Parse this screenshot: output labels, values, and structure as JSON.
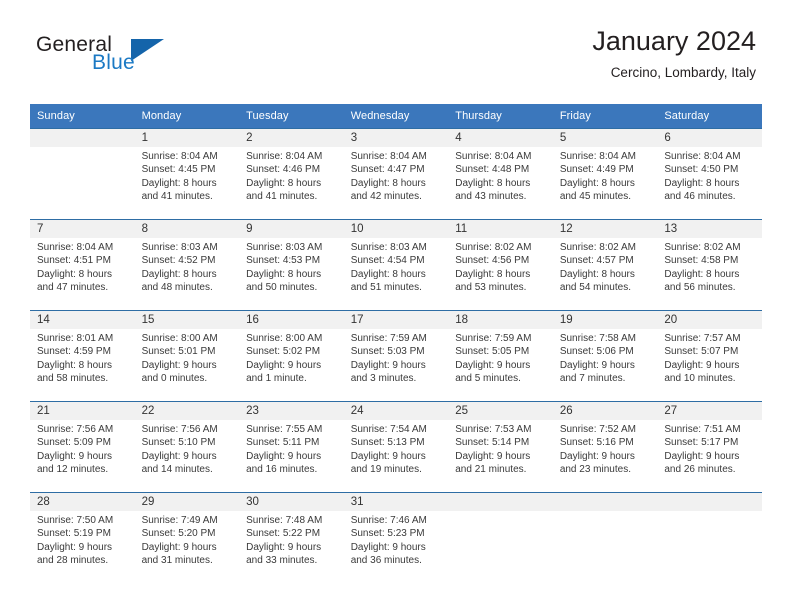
{
  "brand": {
    "name_part1": "General",
    "name_part2": "Blue",
    "triangle_color": "#1464AA",
    "blue_color": "#1B79C4"
  },
  "header": {
    "title": "January 2024",
    "subtitle": "Cercino, Lombardy, Italy"
  },
  "theme": {
    "header_row_bg": "#3B77BC",
    "row_divider": "#2E6DA4",
    "daynum_band_bg": "#F1F1F1",
    "text_color": "#231F20"
  },
  "calendar": {
    "weekday_headers": [
      "Sunday",
      "Monday",
      "Tuesday",
      "Wednesday",
      "Thursday",
      "Friday",
      "Saturday"
    ],
    "weeks": [
      [
        {
          "day": "",
          "sunrise": "",
          "sunset": "",
          "daylight_line1": "",
          "daylight_line2": "",
          "empty": true
        },
        {
          "day": "1",
          "sunrise": "Sunrise: 8:04 AM",
          "sunset": "Sunset: 4:45 PM",
          "daylight_line1": "Daylight: 8 hours",
          "daylight_line2": "and 41 minutes."
        },
        {
          "day": "2",
          "sunrise": "Sunrise: 8:04 AM",
          "sunset": "Sunset: 4:46 PM",
          "daylight_line1": "Daylight: 8 hours",
          "daylight_line2": "and 41 minutes."
        },
        {
          "day": "3",
          "sunrise": "Sunrise: 8:04 AM",
          "sunset": "Sunset: 4:47 PM",
          "daylight_line1": "Daylight: 8 hours",
          "daylight_line2": "and 42 minutes."
        },
        {
          "day": "4",
          "sunrise": "Sunrise: 8:04 AM",
          "sunset": "Sunset: 4:48 PM",
          "daylight_line1": "Daylight: 8 hours",
          "daylight_line2": "and 43 minutes."
        },
        {
          "day": "5",
          "sunrise": "Sunrise: 8:04 AM",
          "sunset": "Sunset: 4:49 PM",
          "daylight_line1": "Daylight: 8 hours",
          "daylight_line2": "and 45 minutes."
        },
        {
          "day": "6",
          "sunrise": "Sunrise: 8:04 AM",
          "sunset": "Sunset: 4:50 PM",
          "daylight_line1": "Daylight: 8 hours",
          "daylight_line2": "and 46 minutes."
        }
      ],
      [
        {
          "day": "7",
          "sunrise": "Sunrise: 8:04 AM",
          "sunset": "Sunset: 4:51 PM",
          "daylight_line1": "Daylight: 8 hours",
          "daylight_line2": "and 47 minutes."
        },
        {
          "day": "8",
          "sunrise": "Sunrise: 8:03 AM",
          "sunset": "Sunset: 4:52 PM",
          "daylight_line1": "Daylight: 8 hours",
          "daylight_line2": "and 48 minutes."
        },
        {
          "day": "9",
          "sunrise": "Sunrise: 8:03 AM",
          "sunset": "Sunset: 4:53 PM",
          "daylight_line1": "Daylight: 8 hours",
          "daylight_line2": "and 50 minutes."
        },
        {
          "day": "10",
          "sunrise": "Sunrise: 8:03 AM",
          "sunset": "Sunset: 4:54 PM",
          "daylight_line1": "Daylight: 8 hours",
          "daylight_line2": "and 51 minutes."
        },
        {
          "day": "11",
          "sunrise": "Sunrise: 8:02 AM",
          "sunset": "Sunset: 4:56 PM",
          "daylight_line1": "Daylight: 8 hours",
          "daylight_line2": "and 53 minutes."
        },
        {
          "day": "12",
          "sunrise": "Sunrise: 8:02 AM",
          "sunset": "Sunset: 4:57 PM",
          "daylight_line1": "Daylight: 8 hours",
          "daylight_line2": "and 54 minutes."
        },
        {
          "day": "13",
          "sunrise": "Sunrise: 8:02 AM",
          "sunset": "Sunset: 4:58 PM",
          "daylight_line1": "Daylight: 8 hours",
          "daylight_line2": "and 56 minutes."
        }
      ],
      [
        {
          "day": "14",
          "sunrise": "Sunrise: 8:01 AM",
          "sunset": "Sunset: 4:59 PM",
          "daylight_line1": "Daylight: 8 hours",
          "daylight_line2": "and 58 minutes."
        },
        {
          "day": "15",
          "sunrise": "Sunrise: 8:00 AM",
          "sunset": "Sunset: 5:01 PM",
          "daylight_line1": "Daylight: 9 hours",
          "daylight_line2": "and 0 minutes."
        },
        {
          "day": "16",
          "sunrise": "Sunrise: 8:00 AM",
          "sunset": "Sunset: 5:02 PM",
          "daylight_line1": "Daylight: 9 hours",
          "daylight_line2": "and 1 minute."
        },
        {
          "day": "17",
          "sunrise": "Sunrise: 7:59 AM",
          "sunset": "Sunset: 5:03 PM",
          "daylight_line1": "Daylight: 9 hours",
          "daylight_line2": "and 3 minutes."
        },
        {
          "day": "18",
          "sunrise": "Sunrise: 7:59 AM",
          "sunset": "Sunset: 5:05 PM",
          "daylight_line1": "Daylight: 9 hours",
          "daylight_line2": "and 5 minutes."
        },
        {
          "day": "19",
          "sunrise": "Sunrise: 7:58 AM",
          "sunset": "Sunset: 5:06 PM",
          "daylight_line1": "Daylight: 9 hours",
          "daylight_line2": "and 7 minutes."
        },
        {
          "day": "20",
          "sunrise": "Sunrise: 7:57 AM",
          "sunset": "Sunset: 5:07 PM",
          "daylight_line1": "Daylight: 9 hours",
          "daylight_line2": "and 10 minutes."
        }
      ],
      [
        {
          "day": "21",
          "sunrise": "Sunrise: 7:56 AM",
          "sunset": "Sunset: 5:09 PM",
          "daylight_line1": "Daylight: 9 hours",
          "daylight_line2": "and 12 minutes."
        },
        {
          "day": "22",
          "sunrise": "Sunrise: 7:56 AM",
          "sunset": "Sunset: 5:10 PM",
          "daylight_line1": "Daylight: 9 hours",
          "daylight_line2": "and 14 minutes."
        },
        {
          "day": "23",
          "sunrise": "Sunrise: 7:55 AM",
          "sunset": "Sunset: 5:11 PM",
          "daylight_line1": "Daylight: 9 hours",
          "daylight_line2": "and 16 minutes."
        },
        {
          "day": "24",
          "sunrise": "Sunrise: 7:54 AM",
          "sunset": "Sunset: 5:13 PM",
          "daylight_line1": "Daylight: 9 hours",
          "daylight_line2": "and 19 minutes."
        },
        {
          "day": "25",
          "sunrise": "Sunrise: 7:53 AM",
          "sunset": "Sunset: 5:14 PM",
          "daylight_line1": "Daylight: 9 hours",
          "daylight_line2": "and 21 minutes."
        },
        {
          "day": "26",
          "sunrise": "Sunrise: 7:52 AM",
          "sunset": "Sunset: 5:16 PM",
          "daylight_line1": "Daylight: 9 hours",
          "daylight_line2": "and 23 minutes."
        },
        {
          "day": "27",
          "sunrise": "Sunrise: 7:51 AM",
          "sunset": "Sunset: 5:17 PM",
          "daylight_line1": "Daylight: 9 hours",
          "daylight_line2": "and 26 minutes."
        }
      ],
      [
        {
          "day": "28",
          "sunrise": "Sunrise: 7:50 AM",
          "sunset": "Sunset: 5:19 PM",
          "daylight_line1": "Daylight: 9 hours",
          "daylight_line2": "and 28 minutes."
        },
        {
          "day": "29",
          "sunrise": "Sunrise: 7:49 AM",
          "sunset": "Sunset: 5:20 PM",
          "daylight_line1": "Daylight: 9 hours",
          "daylight_line2": "and 31 minutes."
        },
        {
          "day": "30",
          "sunrise": "Sunrise: 7:48 AM",
          "sunset": "Sunset: 5:22 PM",
          "daylight_line1": "Daylight: 9 hours",
          "daylight_line2": "and 33 minutes."
        },
        {
          "day": "31",
          "sunrise": "Sunrise: 7:46 AM",
          "sunset": "Sunset: 5:23 PM",
          "daylight_line1": "Daylight: 9 hours",
          "daylight_line2": "and 36 minutes."
        },
        {
          "day": "",
          "sunrise": "",
          "sunset": "",
          "daylight_line1": "",
          "daylight_line2": "",
          "empty": true
        },
        {
          "day": "",
          "sunrise": "",
          "sunset": "",
          "daylight_line1": "",
          "daylight_line2": "",
          "empty": true
        },
        {
          "day": "",
          "sunrise": "",
          "sunset": "",
          "daylight_line1": "",
          "daylight_line2": "",
          "empty": true
        }
      ]
    ]
  }
}
